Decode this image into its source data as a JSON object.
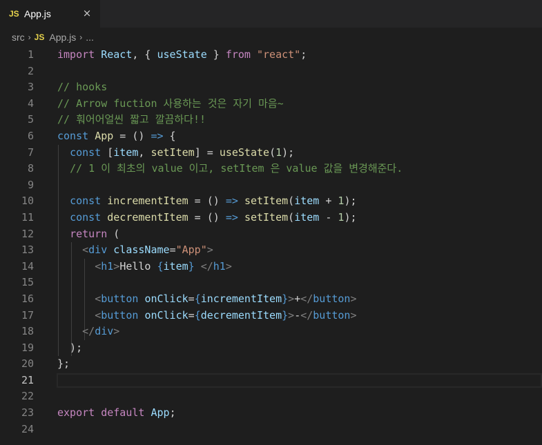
{
  "tab": {
    "badge": "JS",
    "title": "App.js",
    "close": "×"
  },
  "breadcrumb": {
    "folder": "src",
    "sep": "›",
    "badge": "JS",
    "file": "App.js",
    "more": "..."
  },
  "lines": [
    {
      "n": "1",
      "tokens": [
        [
          "ctl",
          "import"
        ],
        [
          "txt",
          " "
        ],
        [
          "var",
          "React"
        ],
        [
          "txt",
          ", { "
        ],
        [
          "var",
          "useState"
        ],
        [
          "txt",
          " } "
        ],
        [
          "ctl",
          "from"
        ],
        [
          "txt",
          " "
        ],
        [
          "str",
          "\"react\""
        ],
        [
          "txt",
          ";"
        ]
      ]
    },
    {
      "n": "2",
      "tokens": []
    },
    {
      "n": "3",
      "tokens": [
        [
          "cmt",
          "// hooks"
        ]
      ]
    },
    {
      "n": "4",
      "tokens": [
        [
          "cmt",
          "// Arrow fuction 사용하는 것은 자기 마음~"
        ]
      ]
    },
    {
      "n": "5",
      "tokens": [
        [
          "cmt",
          "// 훠어어얼씬 짧고 깔끔하다!!"
        ]
      ]
    },
    {
      "n": "6",
      "tokens": [
        [
          "kw",
          "const"
        ],
        [
          "txt",
          " "
        ],
        [
          "fn",
          "App"
        ],
        [
          "txt",
          " = () "
        ],
        [
          "kw",
          "=>"
        ],
        [
          "txt",
          " {"
        ]
      ]
    },
    {
      "n": "7",
      "tokens": [
        [
          "txt",
          "  "
        ],
        [
          "kw",
          "const"
        ],
        [
          "txt",
          " ["
        ],
        [
          "var",
          "item"
        ],
        [
          "txt",
          ", "
        ],
        [
          "fn",
          "setItem"
        ],
        [
          "txt",
          "] = "
        ],
        [
          "fn",
          "useState"
        ],
        [
          "txt",
          "("
        ],
        [
          "num",
          "1"
        ],
        [
          "txt",
          ");"
        ]
      ]
    },
    {
      "n": "8",
      "tokens": [
        [
          "txt",
          "  "
        ],
        [
          "cmt",
          "// 1 이 최초의 value 이고, setItem 은 value 값을 변경해준다."
        ]
      ]
    },
    {
      "n": "9",
      "tokens": []
    },
    {
      "n": "10",
      "tokens": [
        [
          "txt",
          "  "
        ],
        [
          "kw",
          "const"
        ],
        [
          "txt",
          " "
        ],
        [
          "fn",
          "incrementItem"
        ],
        [
          "txt",
          " = () "
        ],
        [
          "kw",
          "=>"
        ],
        [
          "txt",
          " "
        ],
        [
          "fn",
          "setItem"
        ],
        [
          "txt",
          "("
        ],
        [
          "var",
          "item"
        ],
        [
          "txt",
          " + "
        ],
        [
          "num",
          "1"
        ],
        [
          "txt",
          ");"
        ]
      ]
    },
    {
      "n": "11",
      "tokens": [
        [
          "txt",
          "  "
        ],
        [
          "kw",
          "const"
        ],
        [
          "txt",
          " "
        ],
        [
          "fn",
          "decrementItem"
        ],
        [
          "txt",
          " = () "
        ],
        [
          "kw",
          "=>"
        ],
        [
          "txt",
          " "
        ],
        [
          "fn",
          "setItem"
        ],
        [
          "txt",
          "("
        ],
        [
          "var",
          "item"
        ],
        [
          "txt",
          " - "
        ],
        [
          "num",
          "1"
        ],
        [
          "txt",
          ");"
        ]
      ]
    },
    {
      "n": "12",
      "tokens": [
        [
          "txt",
          "  "
        ],
        [
          "ctl",
          "return"
        ],
        [
          "txt",
          " ("
        ]
      ]
    },
    {
      "n": "13",
      "tokens": [
        [
          "txt",
          "    "
        ],
        [
          "tagb",
          "<"
        ],
        [
          "tag",
          "div"
        ],
        [
          "txt",
          " "
        ],
        [
          "attr",
          "className"
        ],
        [
          "txt",
          "="
        ],
        [
          "str",
          "\"App\""
        ],
        [
          "tagb",
          ">"
        ]
      ]
    },
    {
      "n": "14",
      "tokens": [
        [
          "txt",
          "      "
        ],
        [
          "tagb",
          "<"
        ],
        [
          "tag",
          "h1"
        ],
        [
          "tagb",
          ">"
        ],
        [
          "txt",
          "Hello "
        ],
        [
          "brc",
          "{"
        ],
        [
          "var",
          "item"
        ],
        [
          "brc",
          "}"
        ],
        [
          "txt",
          " "
        ],
        [
          "tagb",
          "</"
        ],
        [
          "tag",
          "h1"
        ],
        [
          "tagb",
          ">"
        ]
      ]
    },
    {
      "n": "15",
      "tokens": []
    },
    {
      "n": "16",
      "tokens": [
        [
          "txt",
          "      "
        ],
        [
          "tagb",
          "<"
        ],
        [
          "tag",
          "button"
        ],
        [
          "txt",
          " "
        ],
        [
          "attr",
          "onClick"
        ],
        [
          "txt",
          "="
        ],
        [
          "brc",
          "{"
        ],
        [
          "var",
          "incrementItem"
        ],
        [
          "brc",
          "}"
        ],
        [
          "tagb",
          ">"
        ],
        [
          "txt",
          "+"
        ],
        [
          "tagb",
          "</"
        ],
        [
          "tag",
          "button"
        ],
        [
          "tagb",
          ">"
        ]
      ]
    },
    {
      "n": "17",
      "tokens": [
        [
          "txt",
          "      "
        ],
        [
          "tagb",
          "<"
        ],
        [
          "tag",
          "button"
        ],
        [
          "txt",
          " "
        ],
        [
          "attr",
          "onClick"
        ],
        [
          "txt",
          "="
        ],
        [
          "brc",
          "{"
        ],
        [
          "var",
          "decrementItem"
        ],
        [
          "brc",
          "}"
        ],
        [
          "tagb",
          ">"
        ],
        [
          "txt",
          "-"
        ],
        [
          "tagb",
          "</"
        ],
        [
          "tag",
          "button"
        ],
        [
          "tagb",
          ">"
        ]
      ]
    },
    {
      "n": "18",
      "tokens": [
        [
          "txt",
          "    "
        ],
        [
          "tagb",
          "</"
        ],
        [
          "tag",
          "div"
        ],
        [
          "tagb",
          ">"
        ]
      ]
    },
    {
      "n": "19",
      "tokens": [
        [
          "txt",
          "  );"
        ]
      ]
    },
    {
      "n": "20",
      "tokens": [
        [
          "txt",
          "};"
        ]
      ]
    },
    {
      "n": "21",
      "tokens": []
    },
    {
      "n": "22",
      "tokens": []
    },
    {
      "n": "23",
      "tokens": [
        [
          "ctl",
          "export"
        ],
        [
          "txt",
          " "
        ],
        [
          "ctl",
          "default"
        ],
        [
          "txt",
          " "
        ],
        [
          "var",
          "App"
        ],
        [
          "txt",
          ";"
        ]
      ]
    },
    {
      "n": "24",
      "tokens": []
    }
  ],
  "current_line": "21"
}
